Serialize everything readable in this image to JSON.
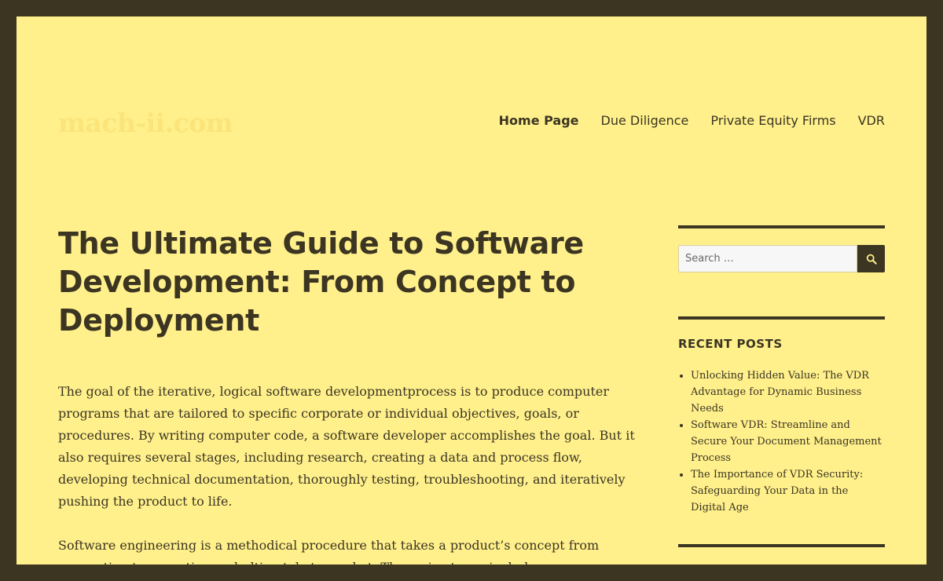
{
  "site": {
    "title": "mach-ii.com"
  },
  "nav": {
    "items": [
      {
        "label": "Home Page",
        "current": true
      },
      {
        "label": "Due Diligence",
        "current": false
      },
      {
        "label": "Private Equity Firms",
        "current": false
      },
      {
        "label": "VDR",
        "current": false
      }
    ]
  },
  "article": {
    "title": "The Ultimate Guide to Software Development: From Concept to Deployment",
    "paragraphs": [
      "The goal of the iterative, logical software developmentprocess is to produce computer programs that are tailored to specific corporate or individual objectives, goals, or procedures. By writing computer code, a software developer accomplishes the goal. But it also requires several stages, including research, creating a data and process flow, developing technical documentation, thoroughly testing, troubleshooting, and iteratively pushing the product to life.",
      "Software engineering is a methodical procedure that takes a product’s concept from conception to execution and ultimately to market. The main stages include:"
    ]
  },
  "sidebar": {
    "search": {
      "placeholder": "Search …",
      "value": "",
      "icon": "search-icon"
    },
    "recent_posts": {
      "title": "RECENT POSTS",
      "items": [
        "Unlocking Hidden Value: The VDR Advantage for Dynamic Business Needs",
        "Software VDR: Streamline and Secure Your Document Management Process",
        "The Importance of VDR Security: Safeguarding Your Data in the Digital Age"
      ]
    }
  },
  "colors": {
    "background": "#fff08c",
    "border": "#3b3522",
    "text": "#3b3522",
    "site_title": "#fbe47a"
  }
}
